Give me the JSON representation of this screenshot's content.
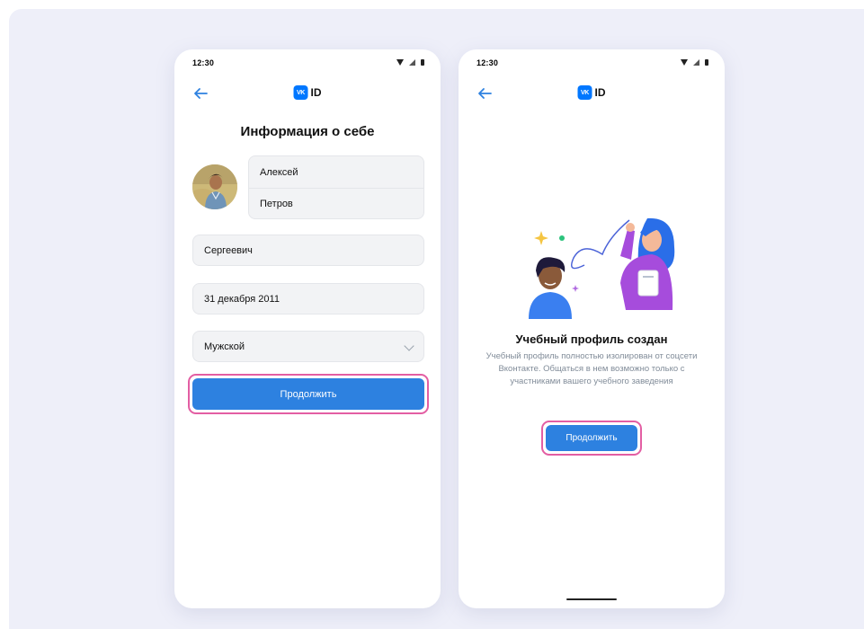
{
  "left_screen": {
    "status_time": "12:30",
    "logo_text": "ID",
    "logo_mark": "VK",
    "title": "Информация о себе",
    "first_name": "Алексей",
    "last_name": "Петров",
    "patronymic": "Сергеевич",
    "birth_date": "31 декабря 2011",
    "gender": "Мужской",
    "continue_label": "Продолжить"
  },
  "right_screen": {
    "status_time": "12:30",
    "logo_text": "ID",
    "logo_mark": "VK",
    "title": "Учебный профиль создан",
    "description": "Учебный профиль полностью изолирован от соцсети Вконтакте. Общаться в нем возможно только с участниками вашего учебного заведения",
    "continue_label": "Продолжить"
  },
  "colors": {
    "accent": "#2d81e0",
    "highlight": "#e35ea3",
    "background": "#eeeff9",
    "logo": "#0077ff"
  },
  "icons": [
    "back-arrow-icon",
    "wifi-icon",
    "signal-icon",
    "battery-icon",
    "chevron-down-icon",
    "vk-logo-icon"
  ]
}
